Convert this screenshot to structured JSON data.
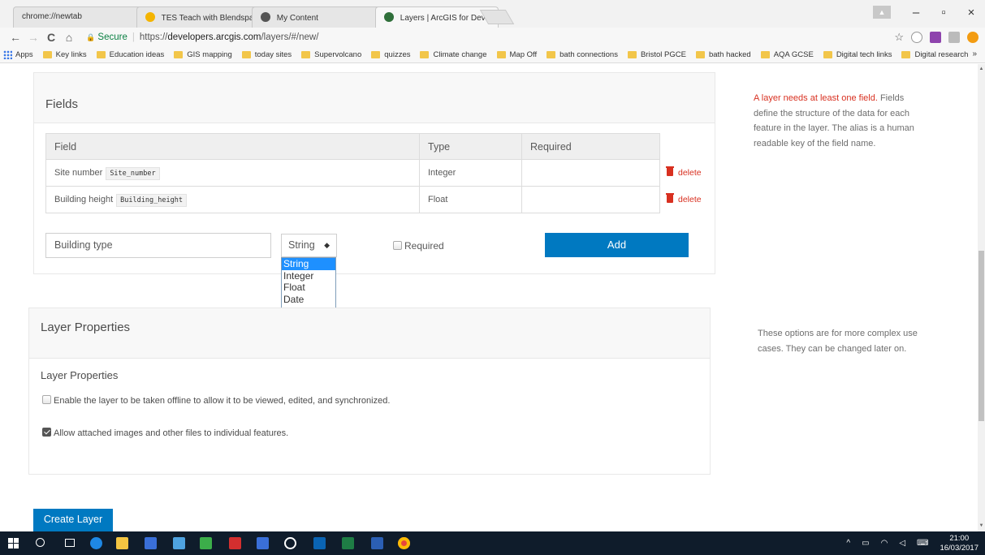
{
  "browser": {
    "tabs": [
      {
        "title": "chrome://newtab",
        "close": "×",
        "favicon_color": ""
      },
      {
        "title": "TES Teach with Blendspa",
        "close": "×",
        "favicon_color": "#f4b400"
      },
      {
        "title": "My Content",
        "close": "×",
        "favicon_color": "#555555"
      },
      {
        "title": "Layers | ArcGIS for Devel",
        "close": "×",
        "favicon_color": "#2f6f3a"
      }
    ],
    "window_controls": {
      "minimize": "–",
      "restore": "▫",
      "close": "×"
    },
    "nav": {
      "back": "←",
      "forward": "→",
      "reload": "C",
      "home": "⌂"
    },
    "address": {
      "secure_label": "Secure",
      "lock": "🔒",
      "scheme": "https://",
      "host": "developers.arcgis.com",
      "path": "/layers/#/new/"
    },
    "star": "☆",
    "bookmarks": [
      "Apps",
      "Key links",
      "Education ideas",
      "GIS mapping",
      "today sites",
      "Supervolcano",
      "quizzes",
      "Climate change",
      "Map Off",
      "bath connections",
      "Bristol PGCE",
      "bath hacked",
      "AQA GCSE",
      "Digital tech links",
      "Digital research"
    ],
    "bookmarks_more": "»"
  },
  "fields_section": {
    "title": "Fields",
    "table": {
      "headers": [
        "Field",
        "Type",
        "Required"
      ],
      "rows": [
        {
          "name": "Site number",
          "alias": "Site_number",
          "type": "Integer",
          "required": "",
          "delete": "delete"
        },
        {
          "name": "Building height",
          "alias": "Building_height",
          "type": "Float",
          "required": "",
          "delete": "delete"
        }
      ]
    },
    "new_field": {
      "name_value": "Building type",
      "type_selected": "String",
      "type_options": [
        "String",
        "Integer",
        "Float",
        "Date"
      ],
      "required_label": "Required",
      "add_label": "Add"
    },
    "help": {
      "warning": "A layer needs at least one field.",
      "text": " Fields define the structure of the data for each feature in the layer. The alias is a human readable key of the field name."
    }
  },
  "layer_properties": {
    "title": "Layer Properties",
    "subtitle": "Layer Properties",
    "options": [
      {
        "label": "Enable the layer to be taken offline to allow it to be viewed, edited, and synchronized.",
        "checked": false
      },
      {
        "label": "Allow attached images and other files to individual features.",
        "checked": true
      }
    ],
    "help": "These options are for more complex use cases. They can be changed later on."
  },
  "create_button": "Create Layer",
  "taskbar": {
    "time": "21:00",
    "date": "16/03/2017"
  }
}
